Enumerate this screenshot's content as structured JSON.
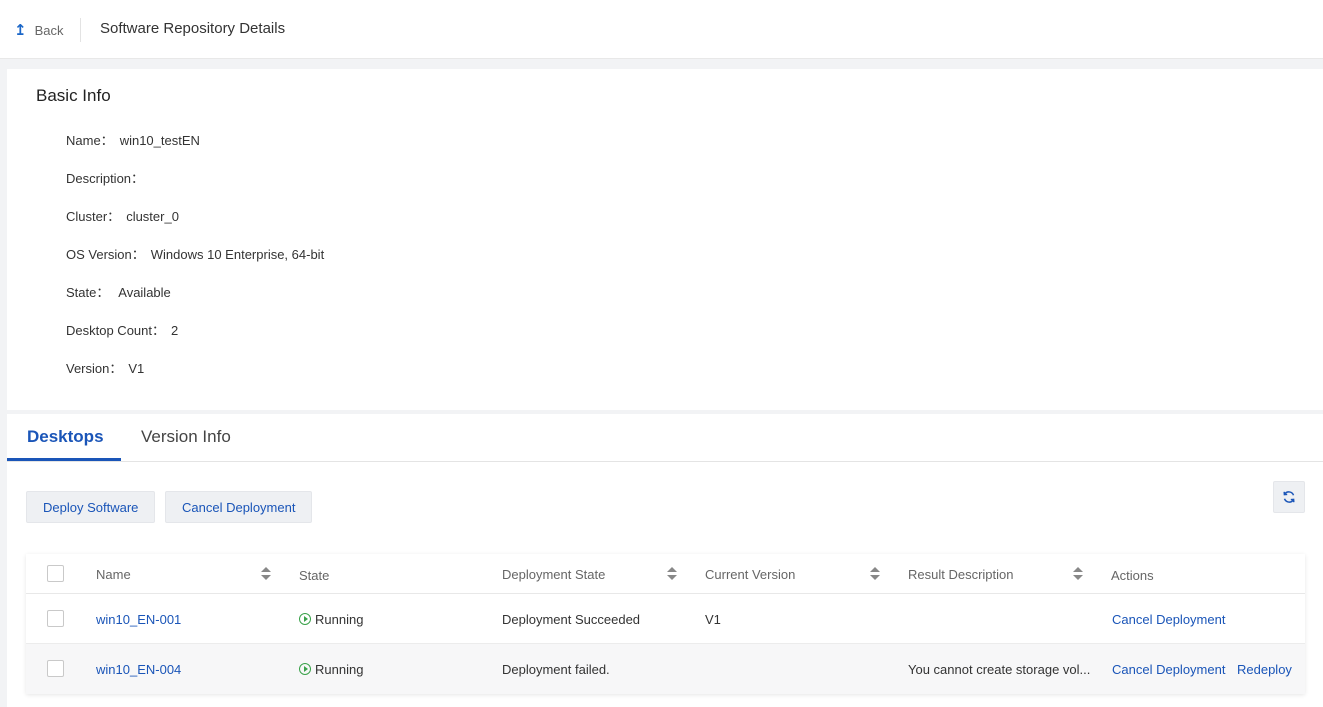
{
  "header": {
    "back_label": "Back",
    "title": "Software Repository Details"
  },
  "basic_info": {
    "title": "Basic Info",
    "fields": [
      {
        "label": "Name：",
        "value": "win10_testEN"
      },
      {
        "label": "Description：",
        "value": ""
      },
      {
        "label": "Cluster：",
        "value": "cluster_0"
      },
      {
        "label": "OS Version：",
        "value": "Windows 10 Enterprise, 64-bit"
      },
      {
        "label": "State：",
        "value": " Available"
      },
      {
        "label": "Desktop Count：",
        "value": "2"
      },
      {
        "label": "Version：",
        "value": "V1"
      }
    ]
  },
  "tabs": [
    {
      "label": "Desktops",
      "active": true
    },
    {
      "label": "Version Info",
      "active": false
    }
  ],
  "toolbar": {
    "deploy_label": "Deploy Software",
    "cancel_label": "Cancel Deployment",
    "refresh_icon": "refresh-icon"
  },
  "table": {
    "columns": [
      "Name",
      "State",
      "Deployment State",
      "Current Version",
      "Result Description",
      "Actions"
    ],
    "rows": [
      {
        "name": "win10_EN-001",
        "state": "Running",
        "deployment_state": "Deployment Succeeded",
        "current_version": "V1",
        "result_description": "",
        "actions": [
          "Cancel Deployment"
        ]
      },
      {
        "name": "win10_EN-004",
        "state": "Running",
        "deployment_state": "Deployment failed.",
        "current_version": "",
        "result_description": "You cannot create storage vol...",
        "actions": [
          "Cancel Deployment",
          "Redeploy"
        ]
      }
    ]
  },
  "colors": {
    "accent": "#1a55b8",
    "running": "#3aa24a"
  }
}
